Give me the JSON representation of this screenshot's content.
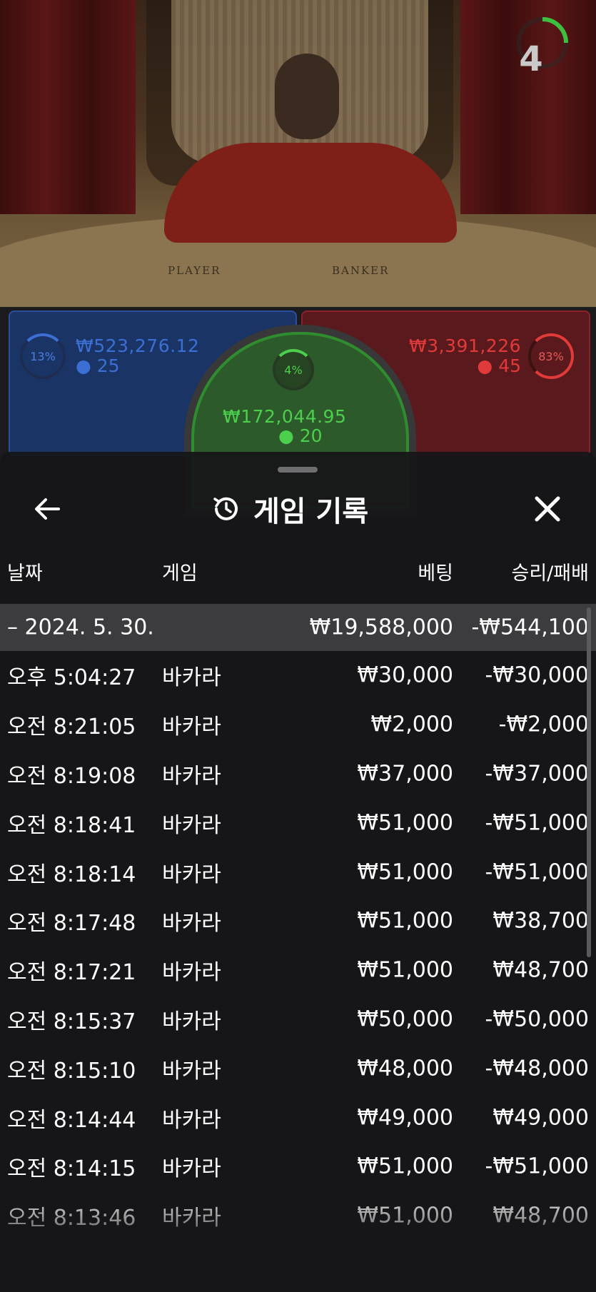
{
  "stream": {
    "table_labels": {
      "player": "PLAYER",
      "banker": "BANKER"
    },
    "countdown": "4"
  },
  "bets": {
    "player": {
      "percent": "13%",
      "amount": "₩523,276.12",
      "players": "25",
      "color": "#3b6fd4"
    },
    "tie": {
      "percent": "4%",
      "amount": "₩172,044.95",
      "players": "20",
      "color": "#4ccf4c"
    },
    "banker": {
      "percent": "83%",
      "amount": "₩3,391,226",
      "players": "45",
      "color": "#e03a3a"
    }
  },
  "history_sheet": {
    "title": "게임 기록",
    "icons": {
      "back": "arrow-left-icon",
      "history": "history-clock-icon",
      "close": "close-icon"
    },
    "columns": {
      "date": "날짜",
      "game": "게임",
      "bet": "베팅",
      "result": "승리/패배"
    },
    "date_group": {
      "label": "– 2024. 5. 30.",
      "total_bet": "₩19,588,000",
      "total_result": "-₩544,100"
    },
    "rows": [
      {
        "time": "오후 5:04:27",
        "game": "바카라",
        "bet": "₩30,000",
        "result": "-₩30,000"
      },
      {
        "time": "오전 8:21:05",
        "game": "바카라",
        "bet": "₩2,000",
        "result": "-₩2,000"
      },
      {
        "time": "오전 8:19:08",
        "game": "바카라",
        "bet": "₩37,000",
        "result": "-₩37,000"
      },
      {
        "time": "오전 8:18:41",
        "game": "바카라",
        "bet": "₩51,000",
        "result": "-₩51,000"
      },
      {
        "time": "오전 8:18:14",
        "game": "바카라",
        "bet": "₩51,000",
        "result": "-₩51,000"
      },
      {
        "time": "오전 8:17:48",
        "game": "바카라",
        "bet": "₩51,000",
        "result": "₩38,700"
      },
      {
        "time": "오전 8:17:21",
        "game": "바카라",
        "bet": "₩51,000",
        "result": "₩48,700"
      },
      {
        "time": "오전 8:15:37",
        "game": "바카라",
        "bet": "₩50,000",
        "result": "-₩50,000"
      },
      {
        "time": "오전 8:15:10",
        "game": "바카라",
        "bet": "₩48,000",
        "result": "-₩48,000"
      },
      {
        "time": "오전 8:14:44",
        "game": "바카라",
        "bet": "₩49,000",
        "result": "₩49,000"
      },
      {
        "time": "오전 8:14:15",
        "game": "바카라",
        "bet": "₩51,000",
        "result": "-₩51,000"
      },
      {
        "time": "오전 8:13:46",
        "game": "바카라",
        "bet": "₩51,000",
        "result": "₩48,700"
      }
    ]
  }
}
